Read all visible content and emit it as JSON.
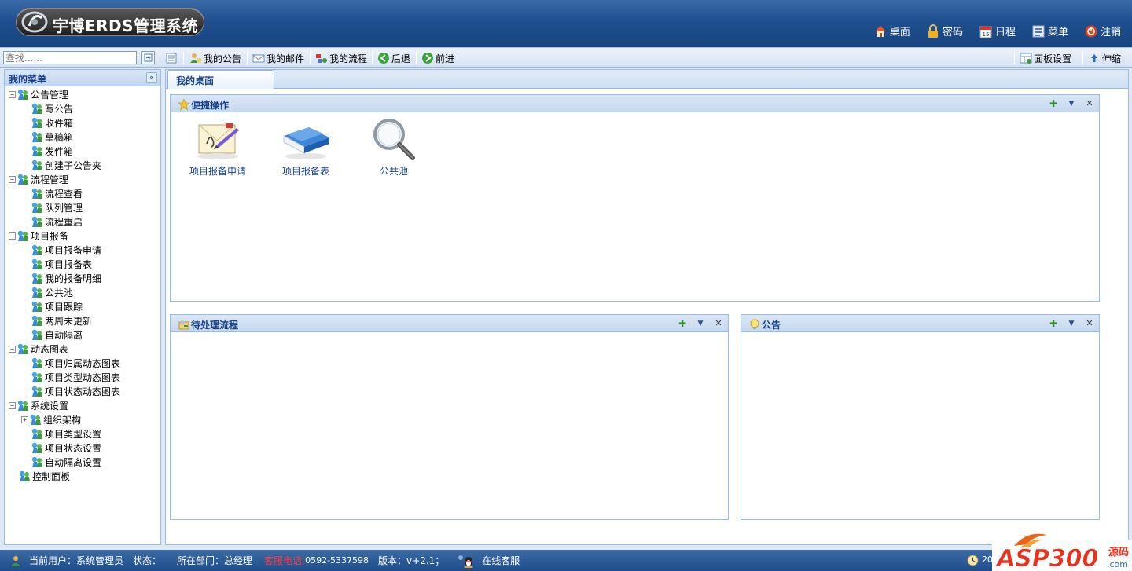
{
  "app": {
    "title": "宇博ERDS管理系统"
  },
  "topnav": [
    {
      "label": "桌面",
      "icon": "home-icon"
    },
    {
      "label": "密码",
      "icon": "lock-icon"
    },
    {
      "label": "日程",
      "icon": "calendar-icon"
    },
    {
      "label": "菜单",
      "icon": "menu-icon"
    },
    {
      "label": "注销",
      "icon": "logout-icon"
    }
  ],
  "search": {
    "placeholder": "查找......"
  },
  "toolbar": {
    "notice": "我的公告",
    "mail": "我的邮件",
    "flow": "我的流程",
    "back": "后退",
    "forward": "前进",
    "panel_settings": "面板设置",
    "stretch": "伸缩"
  },
  "sidebar": {
    "title": "我的菜单",
    "tree": [
      {
        "label": "公告管理",
        "children": [
          "写公告",
          "收件箱",
          "草稿箱",
          "发件箱",
          "创建子公告夹"
        ]
      },
      {
        "label": "流程管理",
        "children": [
          "流程查看",
          "队列管理",
          "流程重启"
        ]
      },
      {
        "label": "项目报备",
        "children": [
          "项目报备申请",
          "项目报备表",
          "我的报备明细",
          "公共池",
          "项目跟踪",
          "两周未更新",
          "自动隔离"
        ]
      },
      {
        "label": "动态图表",
        "children": [
          "项目归属动态图表",
          "项目类型动态图表",
          "项目状态动态图表"
        ]
      },
      {
        "label": "系统设置",
        "children": [
          "组织架构",
          "项目类型设置",
          "项目状态设置",
          "自动隔离设置"
        ]
      },
      {
        "label": "控制面板",
        "children": []
      }
    ]
  },
  "main": {
    "tab": "我的桌面",
    "quick_panel": {
      "title": "便捷操作",
      "items": [
        {
          "label": "项目报备申请",
          "icon": "letter-pen-icon"
        },
        {
          "label": "项目报备表",
          "icon": "blue-book-icon"
        },
        {
          "label": "公共池",
          "icon": "magnifier-icon"
        }
      ]
    },
    "pending_panel": {
      "title": "待处理流程"
    },
    "notice_panel": {
      "title": "公告"
    }
  },
  "statusbar": {
    "user": "当前用户：系统管理员",
    "status": "状态：",
    "dept": "所在部门：总经理",
    "hotline_label": "客服电话:",
    "hotline": "0592-5337598",
    "version": "版本：v+2.1；",
    "online": "在线客服",
    "clock_partial": "201"
  },
  "brand": {
    "text": "ASP300",
    "suffix": "源码",
    "domain": ".com"
  }
}
